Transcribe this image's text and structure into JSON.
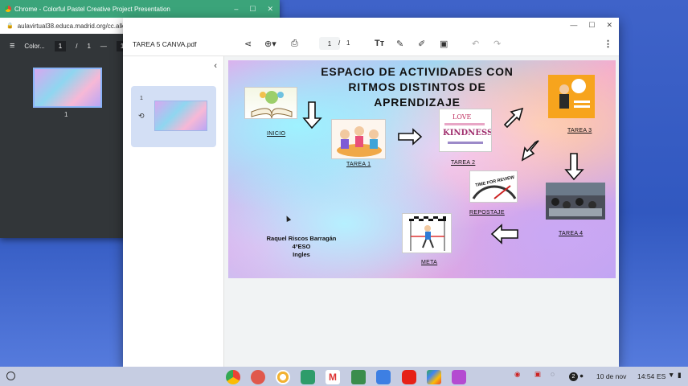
{
  "background_window": {
    "title": "Chrome - Colorful Pastel Creative Project Presentation",
    "url": "aulavirtual38.educa.madrid.org/cc.alk",
    "toolbar_name": "Color...",
    "page_current": "1",
    "page_total": "1",
    "zoom_partial": "1",
    "thumb_page_number": "1"
  },
  "viewer": {
    "file_name": "TAREA 5 CANVA.pdf",
    "page_current": "1",
    "page_separator": "/",
    "page_total": "1",
    "thumbnail_number": "1"
  },
  "slide": {
    "title_lines": [
      "ESPACIO DE ACTIVIDADES CON",
      "RITMOS DISTINTOS DE",
      "APRENDIZAJE"
    ],
    "labels": {
      "inicio": "INICIO",
      "tarea1": "TAREA 1",
      "tarea2": "TAREA 2",
      "tarea3": "TAREA 3",
      "tarea4": "TAREA 4",
      "repostaje": "REPOSTAJE",
      "meta": "META"
    },
    "author_lines": [
      "Raquel Riscos Barragán",
      "4ºESO",
      "Ingles"
    ],
    "picture_words": {
      "love": "LOVE",
      "kindness": "KINDNESS",
      "review": "TIME FOR REVIEW"
    }
  },
  "shelf": {
    "date": "10 de nov",
    "time": "14:54",
    "locale": "ES",
    "notification_count": "2"
  },
  "colors": {
    "background_title_bar": "#3ba47a",
    "desktop": "#3158c0",
    "shelf": "#c6cde2",
    "thumbnail_selection": "#d3dff5"
  }
}
